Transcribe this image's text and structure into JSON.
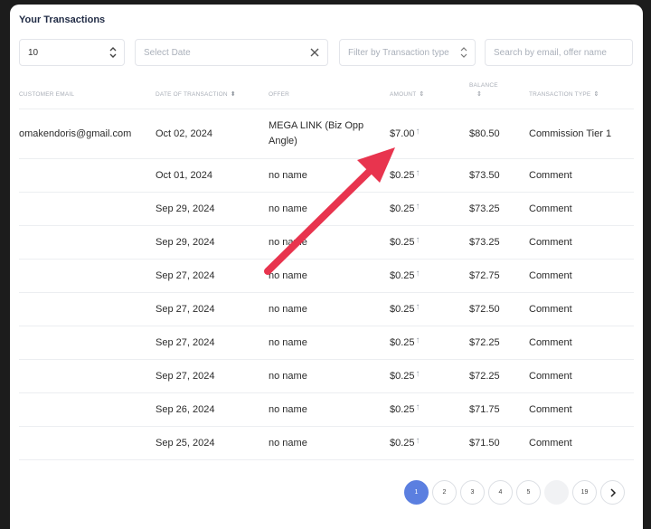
{
  "title": "Your Transactions",
  "controls": {
    "page_size": "10",
    "date_placeholder": "Select Date",
    "type_placeholder": "Filter by Transaction type",
    "search_placeholder": "Search by email, offer name"
  },
  "columns": [
    {
      "label": "CUSTOMER EMAIL",
      "sortable": false
    },
    {
      "label": "DATE OF TRANSACTION",
      "sortable": true
    },
    {
      "label": "OFFER",
      "sortable": false
    },
    {
      "label": "AMOUNT",
      "sortable": true
    },
    {
      "label": "BALANCE",
      "sortable": true
    },
    {
      "label": "TRANSACTION TYPE",
      "sortable": true
    }
  ],
  "rows": [
    {
      "email": "omakendoris@gmail.com",
      "date": "Oct 02, 2024",
      "offer": "MEGA LINK (Biz Opp Angle)",
      "amount": "$7.00",
      "balance": "$80.50",
      "type": "Commission Tier 1"
    },
    {
      "email": "",
      "date": "Oct 01, 2024",
      "offer": "no name",
      "amount": "$0.25",
      "balance": "$73.50",
      "type": "Comment"
    },
    {
      "email": "",
      "date": "Sep 29, 2024",
      "offer": "no name",
      "amount": "$0.25",
      "balance": "$73.25",
      "type": "Comment"
    },
    {
      "email": "",
      "date": "Sep 29, 2024",
      "offer": "no name",
      "amount": "$0.25",
      "balance": "$73.25",
      "type": "Comment"
    },
    {
      "email": "",
      "date": "Sep 27, 2024",
      "offer": "no name",
      "amount": "$0.25",
      "balance": "$72.75",
      "type": "Comment"
    },
    {
      "email": "",
      "date": "Sep 27, 2024",
      "offer": "no name",
      "amount": "$0.25",
      "balance": "$72.50",
      "type": "Comment"
    },
    {
      "email": "",
      "date": "Sep 27, 2024",
      "offer": "no name",
      "amount": "$0.25",
      "balance": "$72.25",
      "type": "Comment"
    },
    {
      "email": "",
      "date": "Sep 27, 2024",
      "offer": "no name",
      "amount": "$0.25",
      "balance": "$72.25",
      "type": "Comment"
    },
    {
      "email": "",
      "date": "Sep 26, 2024",
      "offer": "no name",
      "amount": "$0.25",
      "balance": "$71.75",
      "type": "Comment"
    },
    {
      "email": "",
      "date": "Sep 25, 2024",
      "offer": "no name",
      "amount": "$0.25",
      "balance": "$71.50",
      "type": "Comment"
    }
  ],
  "pagination": {
    "pages": [
      "1",
      "2",
      "3",
      "4",
      "5",
      "...",
      "19"
    ],
    "current": "1",
    "next_icon": "chevron-right-icon"
  },
  "colors": {
    "accent": "#5b7fe0",
    "annotation_arrow": "#e8344e"
  }
}
